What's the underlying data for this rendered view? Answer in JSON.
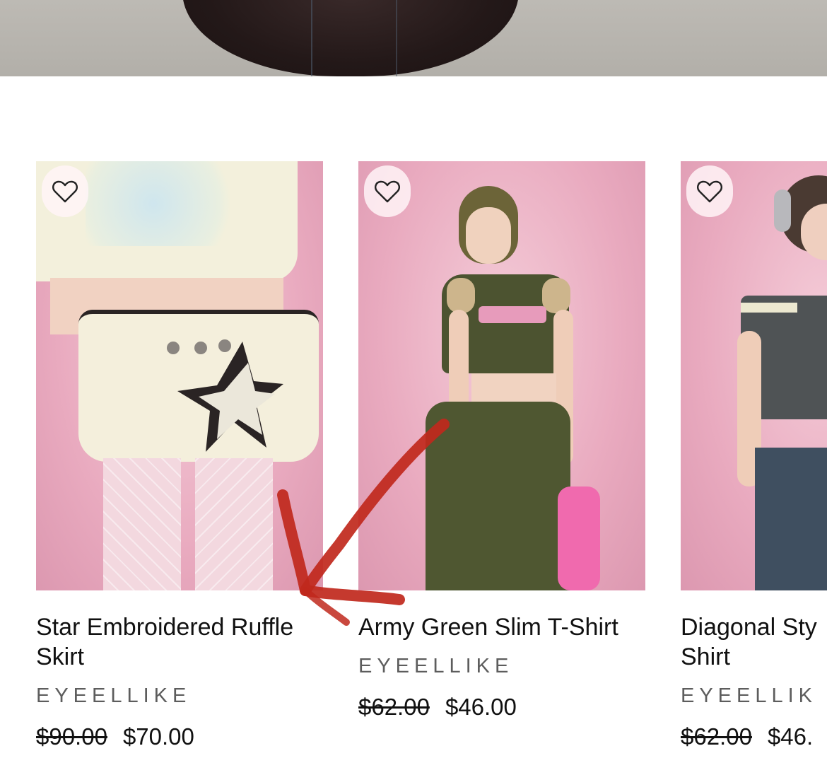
{
  "products": [
    {
      "title": "Star Embroidered Ruffle Skirt",
      "brand": "EYEELLIKE",
      "price_original": "$90.00",
      "price_sale": "$70.00",
      "wishlist_icon": "heart-outline-icon"
    },
    {
      "title": "Army Green Slim T-Shirt",
      "brand": "EYEELLIKE",
      "price_original": "$62.00",
      "price_sale": "$46.00",
      "wishlist_icon": "heart-outline-icon"
    },
    {
      "title": "Diagonal Sty",
      "title_line2": "Shirt",
      "brand": "EYEELLIK",
      "price_original": "$62.00",
      "price_sale": "$46.",
      "wishlist_icon": "heart-outline-icon"
    }
  ],
  "colors": {
    "background": "#ffffff",
    "photo_pink": "#e9aabf",
    "brand_gray": "#5d5d5d",
    "annotation_red": "#c0281c"
  }
}
